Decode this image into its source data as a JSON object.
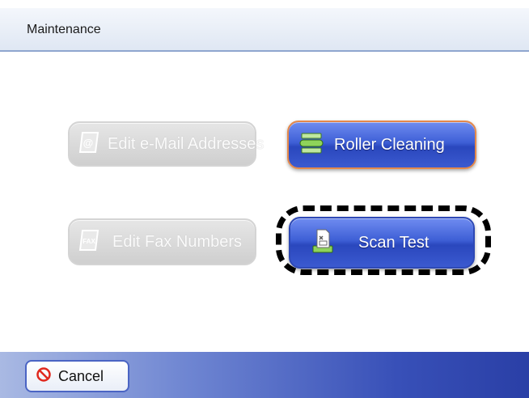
{
  "header": {
    "title": "Maintenance"
  },
  "buttons": {
    "edit_email": {
      "label": "Edit e-Mail Addresses",
      "icon": "email-book-icon",
      "enabled": false
    },
    "roller_cleaning": {
      "label": "Roller Cleaning",
      "icon": "roller-icon",
      "enabled": true
    },
    "edit_fax": {
      "label": "Edit Fax Numbers",
      "icon": "fax-book-icon",
      "enabled": false
    },
    "scan_test": {
      "label": "Scan Test",
      "icon": "scan-document-icon",
      "enabled": true
    }
  },
  "footer": {
    "cancel_label": "Cancel",
    "cancel_icon": "prohibited-icon"
  },
  "colors": {
    "accent_blue": "#3e5fd6",
    "disabled_gray": "#d4d4d4",
    "focus_orange": "#e4894b",
    "footer_blue": "#3850b8"
  }
}
